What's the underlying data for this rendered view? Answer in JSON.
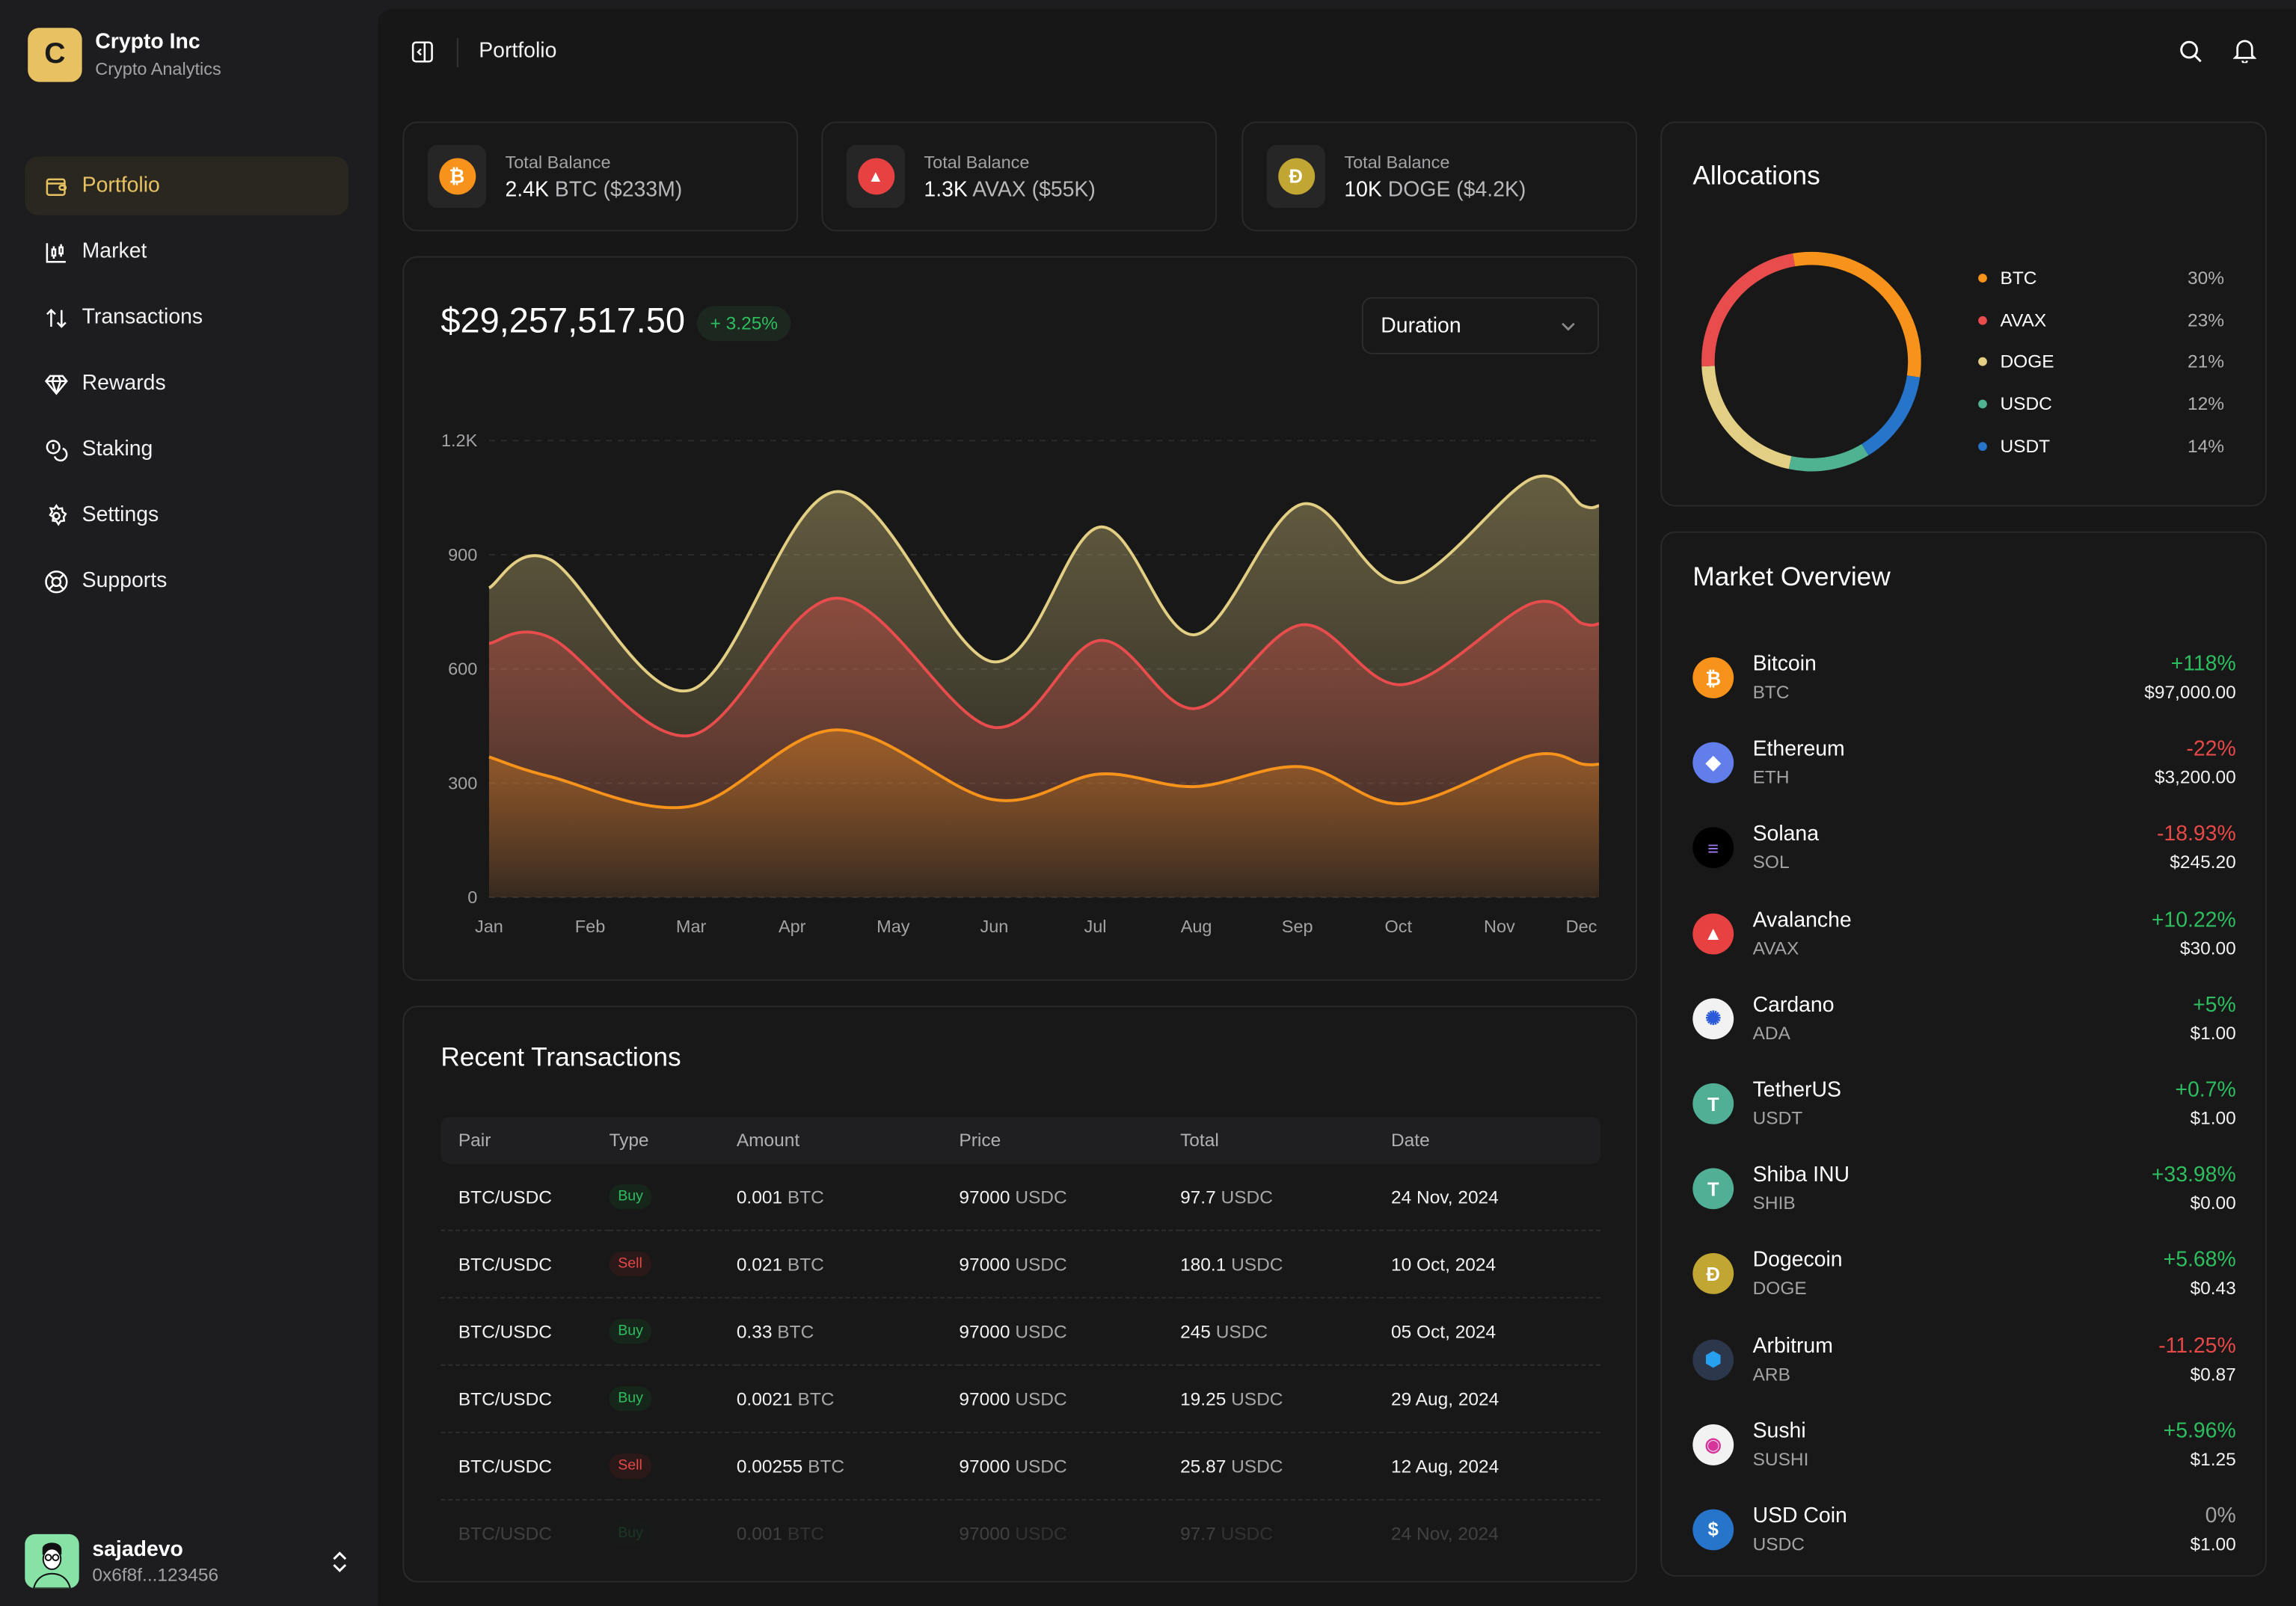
{
  "brand": {
    "logo_letter": "C",
    "name": "Crypto Inc",
    "subtitle": "Crypto Analytics"
  },
  "sidebar": {
    "items": [
      {
        "label": "Portfolio",
        "icon": "wallet-icon",
        "active": true
      },
      {
        "label": "Market",
        "icon": "candlestick-chart-icon",
        "active": false
      },
      {
        "label": "Transactions",
        "icon": "arrows-up-down-icon",
        "active": false
      },
      {
        "label": "Rewards",
        "icon": "gem-icon",
        "active": false
      },
      {
        "label": "Staking",
        "icon": "coins-icon",
        "active": false
      },
      {
        "label": "Settings",
        "icon": "gear-icon",
        "active": false
      },
      {
        "label": "Supports",
        "icon": "lifebuoy-icon",
        "active": false
      }
    ]
  },
  "user": {
    "name": "sajadevo",
    "address": "0x6f8f...123456"
  },
  "header": {
    "title": "Portfolio"
  },
  "balances": [
    {
      "label": "Total Balance",
      "amount": "2.4K",
      "unit": "BTC ($233M)",
      "coin": "BTC",
      "color": "#f7931a"
    },
    {
      "label": "Total Balance",
      "amount": "1.3K",
      "unit": "AVAX ($55K)",
      "coin": "AVAX",
      "color": "#e84142"
    },
    {
      "label": "Total Balance",
      "amount": "10K",
      "unit": "DOGE ($4.2K)",
      "coin": "DOGE",
      "color": "#c2a633"
    }
  ],
  "portfolio": {
    "total": "$29,257,517.50",
    "change": "+ 3.25%",
    "duration_label": "Duration"
  },
  "chart_data": {
    "type": "area",
    "stacked": true,
    "title": "",
    "xlabel": "",
    "ylabel": "",
    "ylim": [
      0,
      1200
    ],
    "yticks": [
      "0",
      "300",
      "600",
      "900",
      "1.2K"
    ],
    "ytick_values": [
      0,
      300,
      600,
      900,
      1200
    ],
    "categories": [
      "Jan",
      "Feb",
      "Mar",
      "Apr",
      "May",
      "Jun",
      "Jul",
      "Aug",
      "Sep",
      "Oct",
      "Nov",
      "Dec"
    ],
    "x": [
      0,
      0.6,
      2,
      3.45,
      5,
      6,
      7,
      8,
      9,
      10,
      11.3,
      12
    ],
    "grid": true,
    "series": [
      {
        "name": "BTC",
        "color": "#f7931a",
        "cumulative_values": [
          369,
          317,
          239,
          440,
          257,
          324,
          291,
          343,
          246,
          373,
          350,
          350
        ]
      },
      {
        "name": "AVAX",
        "color": "#e84c4c",
        "cumulative_values": [
          667,
          682,
          425,
          786,
          447,
          675,
          496,
          716,
          559,
          772,
          719,
          719
        ]
      },
      {
        "name": "DOGE",
        "color": "#e3cf83",
        "cumulative_values": [
          813,
          887,
          544,
          1066,
          619,
          973,
          690,
          1033,
          827,
          1100,
          1029,
          1029
        ]
      }
    ]
  },
  "transactions": {
    "title": "Recent Transactions",
    "columns": [
      "Pair",
      "Type",
      "Amount",
      "Price",
      "Total",
      "Date"
    ],
    "rows": [
      {
        "pair": "BTC/USDC",
        "type": "Buy",
        "amount": "0.001",
        "amount_unit": "BTC",
        "price": "97000",
        "price_unit": "USDC",
        "total": "97.7",
        "total_unit": "USDC",
        "date": "24 Nov, 2024"
      },
      {
        "pair": "BTC/USDC",
        "type": "Sell",
        "amount": "0.021",
        "amount_unit": "BTC",
        "price": "97000",
        "price_unit": "USDC",
        "total": "180.1",
        "total_unit": "USDC",
        "date": "10 Oct, 2024"
      },
      {
        "pair": "BTC/USDC",
        "type": "Buy",
        "amount": "0.33",
        "amount_unit": "BTC",
        "price": "97000",
        "price_unit": "USDC",
        "total": "245",
        "total_unit": "USDC",
        "date": "05 Oct, 2024"
      },
      {
        "pair": "BTC/USDC",
        "type": "Buy",
        "amount": "0.0021",
        "amount_unit": "BTC",
        "price": "97000",
        "price_unit": "USDC",
        "total": "19.25",
        "total_unit": "USDC",
        "date": "29 Aug, 2024"
      },
      {
        "pair": "BTC/USDC",
        "type": "Sell",
        "amount": "0.00255",
        "amount_unit": "BTC",
        "price": "97000",
        "price_unit": "USDC",
        "total": "25.87",
        "total_unit": "USDC",
        "date": "12 Aug, 2024"
      },
      {
        "pair": "BTC/USDC",
        "type": "Buy",
        "amount": "0.001",
        "amount_unit": "BTC",
        "price": "97000",
        "price_unit": "USDC",
        "total": "97.7",
        "total_unit": "USDC",
        "date": "24 Nov, 2024"
      }
    ]
  },
  "allocations": {
    "title": "Allocations",
    "items": [
      {
        "name": "BTC",
        "pct": "30%",
        "value": 30,
        "color": "#f7931a"
      },
      {
        "name": "AVAX",
        "pct": "23%",
        "value": 23,
        "color": "#e84c4c"
      },
      {
        "name": "DOGE",
        "pct": "21%",
        "value": 21,
        "color": "#e3cf83"
      },
      {
        "name": "USDC",
        "pct": "12%",
        "value": 12,
        "color": "#4fb391"
      },
      {
        "name": "USDT",
        "pct": "14%",
        "value": 14,
        "color": "#2775ca"
      }
    ]
  },
  "market": {
    "title": "Market Overview",
    "items": [
      {
        "name": "Bitcoin",
        "symbol": "BTC",
        "change": "+118%",
        "trend": "pos",
        "price": "$97,000.00",
        "color": "#f7931a",
        "glyph": "₿"
      },
      {
        "name": "Ethereum",
        "symbol": "ETH",
        "change": "-22%",
        "trend": "neg",
        "price": "$3,200.00",
        "color": "#627eea",
        "glyph": "◆"
      },
      {
        "name": "Solana",
        "symbol": "SOL",
        "change": "-18.93%",
        "trend": "neg",
        "price": "$245.20",
        "color": "#000000",
        "glyph": "≡"
      },
      {
        "name": "Avalanche",
        "symbol": "AVAX",
        "change": "+10.22%",
        "trend": "pos",
        "price": "$30.00",
        "color": "#e84142",
        "glyph": "▲"
      },
      {
        "name": "Cardano",
        "symbol": "ADA",
        "change": "+5%",
        "trend": "pos",
        "price": "$1.00",
        "color": "#f2f2f2",
        "glyph": "✺"
      },
      {
        "name": "TetherUS",
        "symbol": "USDT",
        "change": "+0.7%",
        "trend": "pos",
        "price": "$1.00",
        "color": "#50af95",
        "glyph": "T"
      },
      {
        "name": "Shiba INU",
        "symbol": "SHIB",
        "change": "+33.98%",
        "trend": "pos",
        "price": "$0.00",
        "color": "#50af95",
        "glyph": "T"
      },
      {
        "name": "Dogecoin",
        "symbol": "DOGE",
        "change": "+5.68%",
        "trend": "pos",
        "price": "$0.43",
        "color": "#c2a633",
        "glyph": "Ð"
      },
      {
        "name": "Arbitrum",
        "symbol": "ARB",
        "change": "-11.25%",
        "trend": "neg",
        "price": "$0.87",
        "color": "#2d374b",
        "glyph": "⬢"
      },
      {
        "name": "Sushi",
        "symbol": "SUSHI",
        "change": "+5.96%",
        "trend": "pos",
        "price": "$1.25",
        "color": "#f2f2f2",
        "glyph": "◉"
      },
      {
        "name": "USD Coin",
        "symbol": "USDC",
        "change": "0%",
        "trend": "neu",
        "price": "$1.00",
        "color": "#2775ca",
        "glyph": "$"
      }
    ]
  }
}
